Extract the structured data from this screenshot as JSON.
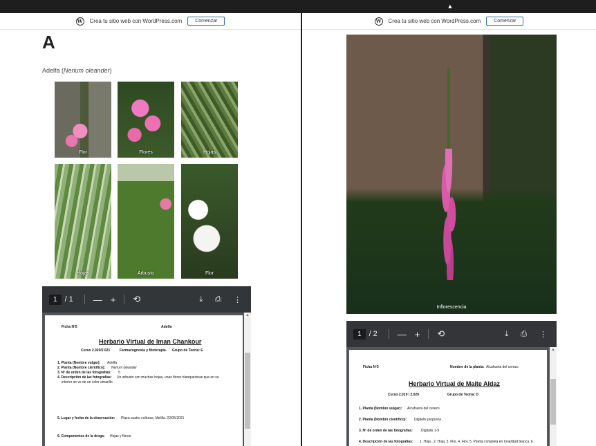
{
  "wp_banner": {
    "text": "Crea tu sitio web con WordPress.com",
    "button": "Comenzar",
    "logo_icon": "wordpress-logo-icon"
  },
  "left": {
    "letter": "A",
    "caption_prefix": "Adelfa (",
    "caption_scientific": "Nerium oleander",
    "caption_suffix": ")",
    "photos": [
      {
        "label": "Flor"
      },
      {
        "label": "Flores"
      },
      {
        "label": "Hojas"
      },
      {
        "label": "Hojas"
      },
      {
        "label": "Arbusto"
      },
      {
        "label": "Flor"
      }
    ],
    "pdf": {
      "page_current": "1",
      "page_of": "/ 1",
      "ficha": "Ficha Nº5",
      "plant_head": "Adelfa",
      "title": "Herbario Virtual de Iman Chankour",
      "course": "Curso 2.020/2.021",
      "subject": "Farmacognosia y fitoterapia.",
      "group": "Grupo de Teoría: E",
      "item1_label": "1. Planta (Nombre vulgar):",
      "item1_value": "Adelfa",
      "item2_label": "2. Planta (Nombre científico):",
      "item2_value": "Nerium oleander",
      "item3_label": "3. Nº de orden de las fotografías:",
      "item3_value": "5",
      "item4_label": "4. Descripción de las fotografías:",
      "item4_value": "Un arbusto con muchas hojas, unas flores blanquecinas que en su",
      "item4_value2": "interior se ve de un color amarillo.",
      "item5_label": "5. Lugar y fecha de la observación:",
      "item5_value": "Plaza cuatro culturas, Melilla. 22/05/2021",
      "item6_label": "6. Componentes de la droga:",
      "item6_value": "Hojas y flores."
    }
  },
  "right": {
    "photo_label": "Inflorescencia",
    "pdf": {
      "page_current": "1",
      "page_of": "/ 2",
      "ficha": "Ficha Nº3",
      "plant_head_label": "Nombre de la planta:",
      "plant_head_value": "Alcahueta del cerezo",
      "title": "Herbario Virtual de Maite Aldaz",
      "course": "Curso 2.019 / 2.020",
      "group": "Grupo de Teoría: D",
      "item1_label": "1. Planta (Nombre vulgar):",
      "item1_value": "Alcahueta del cerezo",
      "item2_label": "2. Planta (Nombre científico):",
      "item2_value": "Digitalis purpurea",
      "item3_label": "3. Nº de orden de las fotografías:",
      "item3_value": "Digitalis 1-9",
      "item4_label": "4. Descripción de las fotografías:",
      "item4_value": "1. Hoja , 2. Hoja, 3. Flor, 4. Flor, 5. Planta completa en tonalidad blanca, 6."
    }
  },
  "toolbar": {
    "minus": "—",
    "plus": "+",
    "rotate_icon": "rotate-icon",
    "download_icon": "download-icon",
    "print_icon": "print-icon",
    "more_icon": "more-icon"
  }
}
